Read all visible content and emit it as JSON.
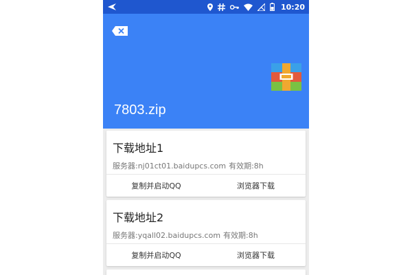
{
  "status_bar": {
    "time": "10:20",
    "icons": [
      "send-icon",
      "location-icon",
      "hash-icon",
      "key-icon",
      "wifi-icon",
      "signal-off-icon",
      "battery-icon"
    ]
  },
  "header": {
    "file_name": "7803.zip",
    "background_color": "#3b82f6",
    "icons": [
      "backspace-icon",
      "archive-icon"
    ]
  },
  "cards": [
    {
      "title": "下载地址1",
      "server": "服务器:nj01ct01.baidupcs.com",
      "validity": "有效期:8h",
      "copy_label": "复制并启动QQ",
      "browser_label": "浏览器下载"
    },
    {
      "title": "下载地址2",
      "server": "服务器:yqall02.baidupcs.com",
      "validity": "有效期:8h",
      "copy_label": "复制并启动QQ",
      "browser_label": "浏览器下载"
    }
  ]
}
